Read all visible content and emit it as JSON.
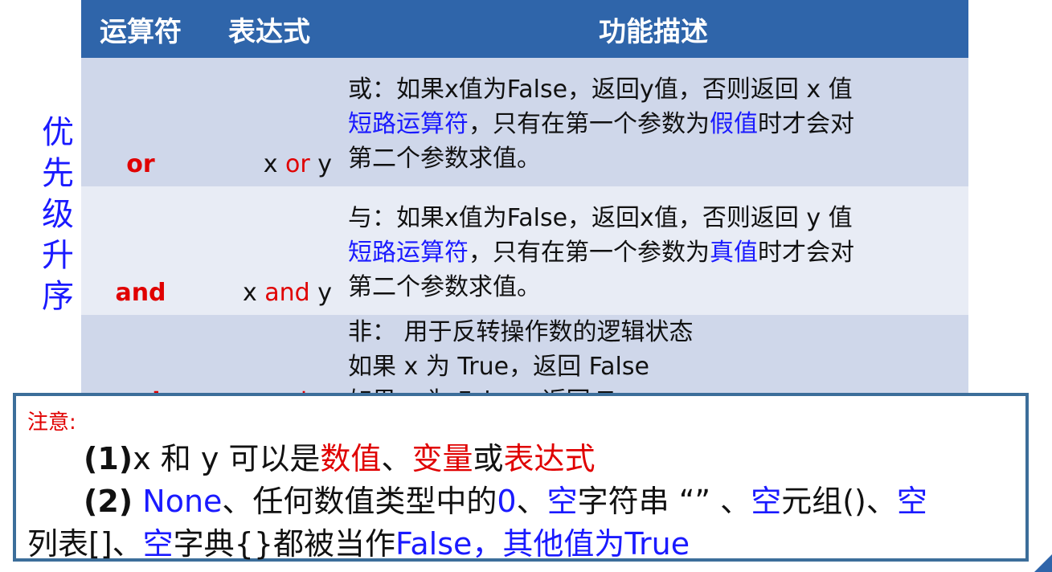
{
  "side_label": [
    "优",
    "先",
    "级",
    "升",
    "序"
  ],
  "table": {
    "headers": {
      "operator": "运算符",
      "expression": "表达式",
      "description": "功能描述"
    },
    "rows": [
      {
        "op": "or",
        "expr": {
          "pre": "x ",
          "op": "or",
          "post": " y"
        },
        "desc": {
          "line1": "或：如果x值为False，返回y值，否则返回 x 值",
          "line2_a": "短路运算符",
          "line2_b": "，只有在第一个参数为",
          "line2_c": "假值",
          "line2_d": "时才会对",
          "line3": "第二个参数求值。"
        }
      },
      {
        "op": "and",
        "expr": {
          "pre": "x ",
          "op": "and",
          "post": " y"
        },
        "desc": {
          "line1": "与：如果x值为False，返回x值，否则返回 y 值",
          "line2_a": "短路运算符",
          "line2_b": "，只有在第一个参数为",
          "line2_c": "真值",
          "line2_d": "时才会对",
          "line3": "第二个参数求值。"
        }
      },
      {
        "op": "not",
        "expr": {
          "op": "not",
          "post": " x"
        },
        "desc": {
          "line1": "非： 用于反转操作数的逻辑状态",
          "line2": "如果 x 为 True，返回 False",
          "line3": "如果 x 为 False，返回 True"
        }
      }
    ]
  },
  "notice": {
    "title": "注意:",
    "line1": {
      "num": "(1)",
      "a": "x 和 y 可以是",
      "b": "数值",
      "c": "、",
      "d": "变量",
      "e": "或",
      "f": "表达式"
    },
    "line2": {
      "num": "(2)",
      "a": " None",
      "b": "、任何数值类型中的",
      "c": "0",
      "d": "、",
      "e": "空",
      "f": "字符串 “” 、",
      "g": "空",
      "h": "元组()、",
      "i": "空"
    },
    "line3": {
      "a": "列表[]、",
      "b": "空",
      "c": "字典{}都被当作",
      "d": "False，其他值为True"
    }
  },
  "colors": {
    "header_bg": "#2f65aa",
    "row_dark": "#cfd7ea",
    "row_light": "#e8ecf5",
    "red": "#e00000",
    "blue": "#1a1aff"
  }
}
